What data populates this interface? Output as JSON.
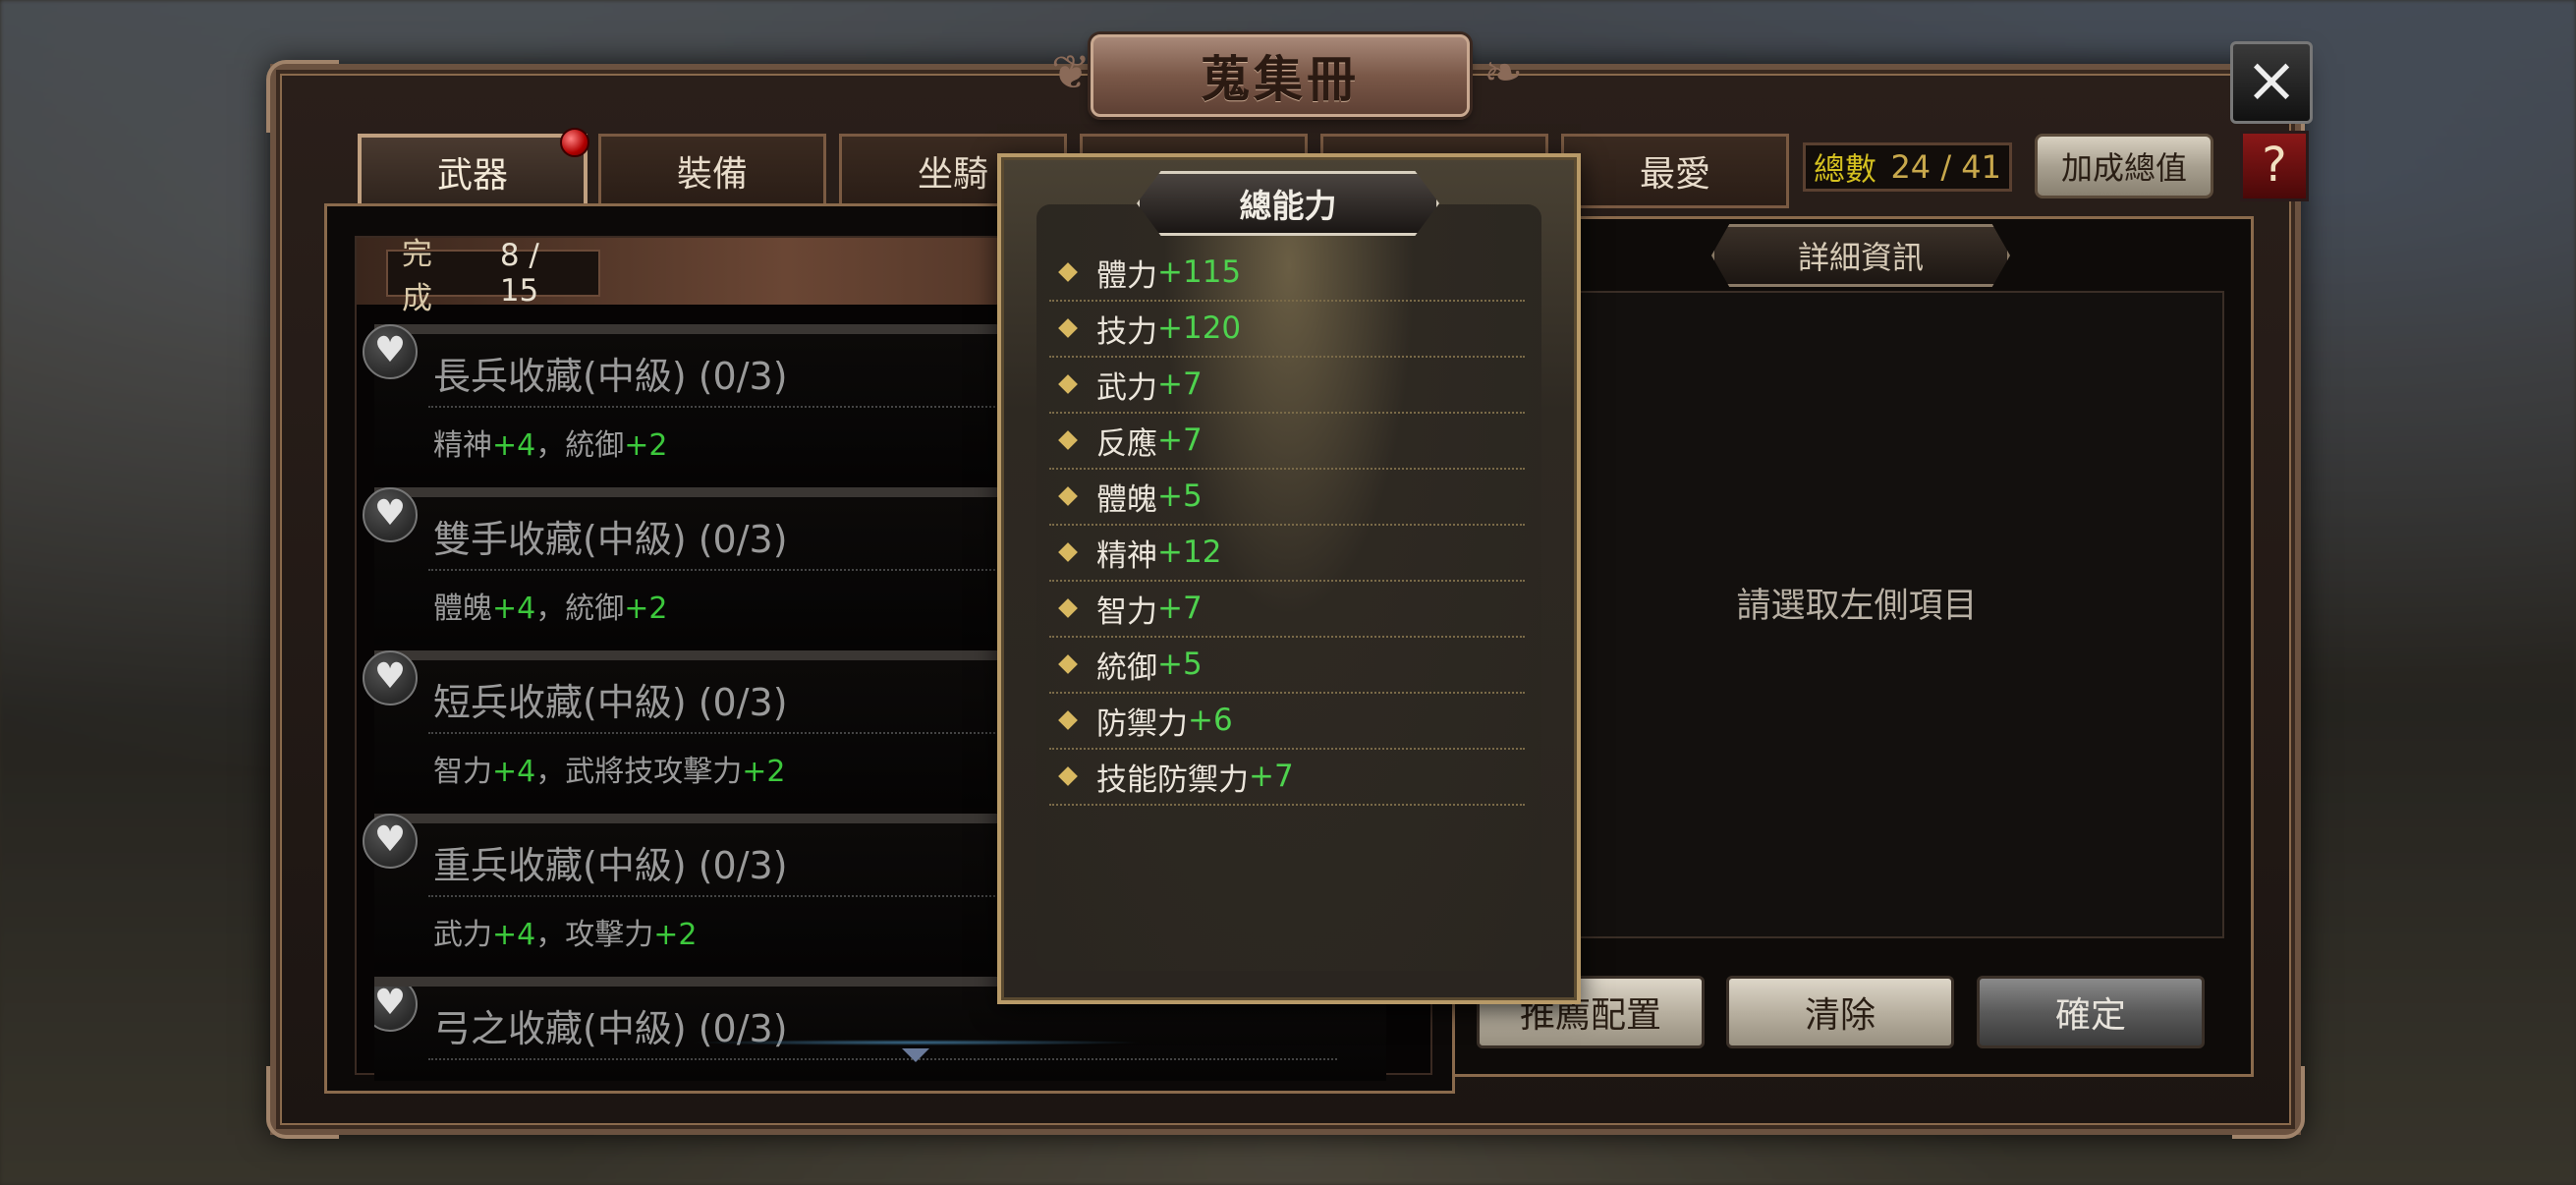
{
  "window": {
    "title": "蒐集冊",
    "close_icon": "×",
    "help_icon": "?"
  },
  "tabs": [
    {
      "label": "武器",
      "active": true,
      "badge": true
    },
    {
      "label": "裝備",
      "active": false
    },
    {
      "label": "坐騎",
      "active": false
    },
    {
      "label": "",
      "active": false
    },
    {
      "label": "",
      "active": false
    },
    {
      "label": "最愛",
      "active": false
    }
  ],
  "total": {
    "label": "總數",
    "value": "24 / 41"
  },
  "bonus_button": "加成總值",
  "completion": {
    "label": "完成",
    "value": "8 / 15"
  },
  "collections": [
    {
      "name": "長兵收藏(中級) (0/3)",
      "stats": [
        {
          "name": "精神",
          "val": "+4"
        },
        {
          "name": "統御",
          "val": "+2"
        }
      ]
    },
    {
      "name": "雙手收藏(中級) (0/3)",
      "stats": [
        {
          "name": "體魄",
          "val": "+4"
        },
        {
          "name": "統御",
          "val": "+2"
        }
      ]
    },
    {
      "name": "短兵收藏(中級) (0/3)",
      "stats": [
        {
          "name": "智力",
          "val": "+4"
        },
        {
          "name": "武將技攻擊力",
          "val": "+2"
        }
      ]
    },
    {
      "name": "重兵收藏(中級) (0/3)",
      "stats": [
        {
          "name": "武力",
          "val": "+4"
        },
        {
          "name": "攻擊力",
          "val": "+2"
        }
      ]
    },
    {
      "name": "弓之收藏(中級) (0/3)",
      "stats": []
    }
  ],
  "detail": {
    "header": "詳細資訊",
    "prompt": "請選取左側項目"
  },
  "actions": {
    "recommend": "推薦配置",
    "clear": "清除",
    "confirm": "確定"
  },
  "popup": {
    "title": "總能力",
    "stats": [
      {
        "name": "體力",
        "val": "+115"
      },
      {
        "name": "技力",
        "val": "+120"
      },
      {
        "name": "武力",
        "val": "+7"
      },
      {
        "name": "反應",
        "val": "+7"
      },
      {
        "name": "體魄",
        "val": "+5"
      },
      {
        "name": "精神",
        "val": "+12"
      },
      {
        "name": "智力",
        "val": "+7"
      },
      {
        "name": "統御",
        "val": "+5"
      },
      {
        "name": "防禦力",
        "val": "+6"
      },
      {
        "name": "技能防禦力",
        "val": "+7"
      }
    ]
  },
  "colors": {
    "stat_green": "#3cc83c",
    "gold": "#d4c020",
    "frame_brown": "#6b5240"
  },
  "icons": {
    "collection_marker": "heart-icon",
    "stat_bullet": "diamond-icon",
    "close": "close-icon",
    "help": "question-icon"
  }
}
